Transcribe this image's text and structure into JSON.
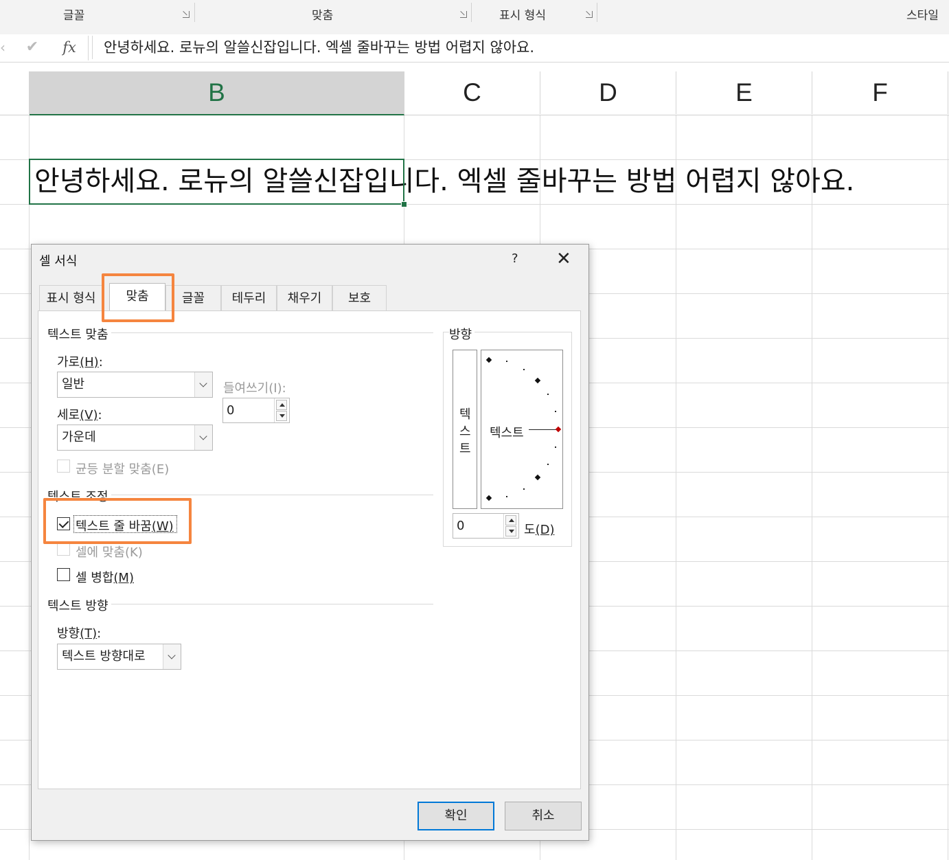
{
  "ribbon": {
    "groups": [
      {
        "label": "글꼴"
      },
      {
        "label": "맞춤"
      },
      {
        "label": "표시 형식"
      },
      {
        "label": "스타일"
      }
    ]
  },
  "formula_bar": {
    "fx_label": "fx",
    "value": "안녕하세요. 로뉴의 알쓸신잡입니다. 엑셀 줄바꾸는 방법 어렵지 않아요."
  },
  "columns": [
    "B",
    "C",
    "D",
    "E",
    "F"
  ],
  "cell_b2": {
    "text": "안녕하세요. 로뉴의 알쓸신잡입니다. 엑셀 줄바꾸는 방법 어렵지 않아요."
  },
  "dialog": {
    "title": "셀 서식",
    "help": "?",
    "close": "✕",
    "tabs": [
      "표시 형식",
      "맞춤",
      "글꼴",
      "테두리",
      "채우기",
      "보호"
    ],
    "text_alignment": {
      "title": "텍스트 맞춤",
      "horizontal_label": "가로",
      "horizontal_key": "(H)",
      "horizontal_value": "일반",
      "vertical_label": "세로",
      "vertical_key": "(V)",
      "vertical_value": "가운데",
      "indent_label": "들여쓰기(I):",
      "indent_value": "0",
      "justify_distributed": "균등 분할 맞춤(E)"
    },
    "text_control": {
      "title": "텍스트 조정",
      "wrap_text_label": "텍스트 줄 바꿈",
      "wrap_text_key": "(W)",
      "wrap_text_checked": true,
      "shrink_to_fit": "셀에 맞춤(K)",
      "merge_cells_label": "셀 병합",
      "merge_cells_key": "(M)"
    },
    "text_direction": {
      "title": "텍스트 방향",
      "direction_label": "방향",
      "direction_key": "(T)",
      "direction_value": "텍스트 방향대로"
    },
    "orientation": {
      "title": "방향",
      "vertical_chars": [
        "텍",
        "스",
        "트"
      ],
      "dial_text": "텍스트",
      "degrees_value": "0",
      "degrees_label": "도",
      "degrees_key": "(D)"
    },
    "ok": "확인",
    "cancel": "취소"
  },
  "colors": {
    "excel_green": "#217346",
    "highlight_orange": "#f5853f",
    "ok_border": "#0078d7"
  }
}
